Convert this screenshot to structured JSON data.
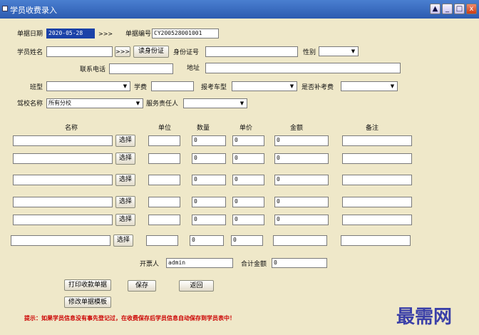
{
  "window": {
    "title": "学员收费录入",
    "min_glyph": "▲",
    "restore_glyph": "_",
    "max_glyph": "□",
    "close_glyph": "x"
  },
  "form": {
    "date_label": "单据日期",
    "date_value": "2020-05-28",
    "date_button": ">>>",
    "doc_no_label": "单据编号",
    "doc_no_value": "CY200528001001",
    "student_name_label": "学员姓名",
    "student_name_value": "",
    "name_lookup_button": ">>>",
    "read_id_button": "读身份证",
    "id_card_label": "身份证号",
    "id_card_value": "",
    "gender_label": "性别",
    "gender_value": "",
    "phone_label": "联系电话",
    "phone_value": "",
    "address_label": "地址",
    "address_value": "",
    "class_label": "班型",
    "class_value": "",
    "fee_label": "学费",
    "fee_value": "",
    "vehicle_label": "报考车型",
    "vehicle_value": "",
    "makeup_label": "是否补考费",
    "makeup_value": "",
    "school_label": "驾校名称",
    "school_value": "所有分校",
    "service_label": "服务责任人",
    "service_value": ""
  },
  "table": {
    "headers": {
      "name": "名称",
      "unit": "单位",
      "qty": "数量",
      "price": "单价",
      "amount": "金额",
      "remark": "备注"
    },
    "select_label": "选择",
    "rows": [
      {
        "name": "",
        "unit": "",
        "qty": "0",
        "price": "0",
        "amount": "0",
        "remark": ""
      },
      {
        "name": "",
        "unit": "",
        "qty": "0",
        "price": "0",
        "amount": "0",
        "remark": ""
      },
      {
        "name": "",
        "unit": "",
        "qty": "0",
        "price": "0",
        "amount": "0",
        "remark": ""
      },
      {
        "name": "",
        "unit": "",
        "qty": "0",
        "price": "0",
        "amount": "0",
        "remark": ""
      },
      {
        "name": "",
        "unit": "",
        "qty": "0",
        "price": "0",
        "amount": "0",
        "remark": ""
      },
      {
        "name": "",
        "unit": "",
        "qty": "0",
        "price": "0",
        "amount": "",
        "remark": ""
      }
    ]
  },
  "footer": {
    "issuer_label": "开票人",
    "issuer_value": "admin",
    "total_label": "合计金额",
    "total_value": "0",
    "print_button": "打印收款单据",
    "save_button": "保存",
    "back_button": "返回",
    "template_button": "修改单据模板",
    "notice": "提示：如果学员信息没有事先登记过，在收费保存后学员信息自动保存到学员表中！",
    "watermark": "最需网"
  }
}
